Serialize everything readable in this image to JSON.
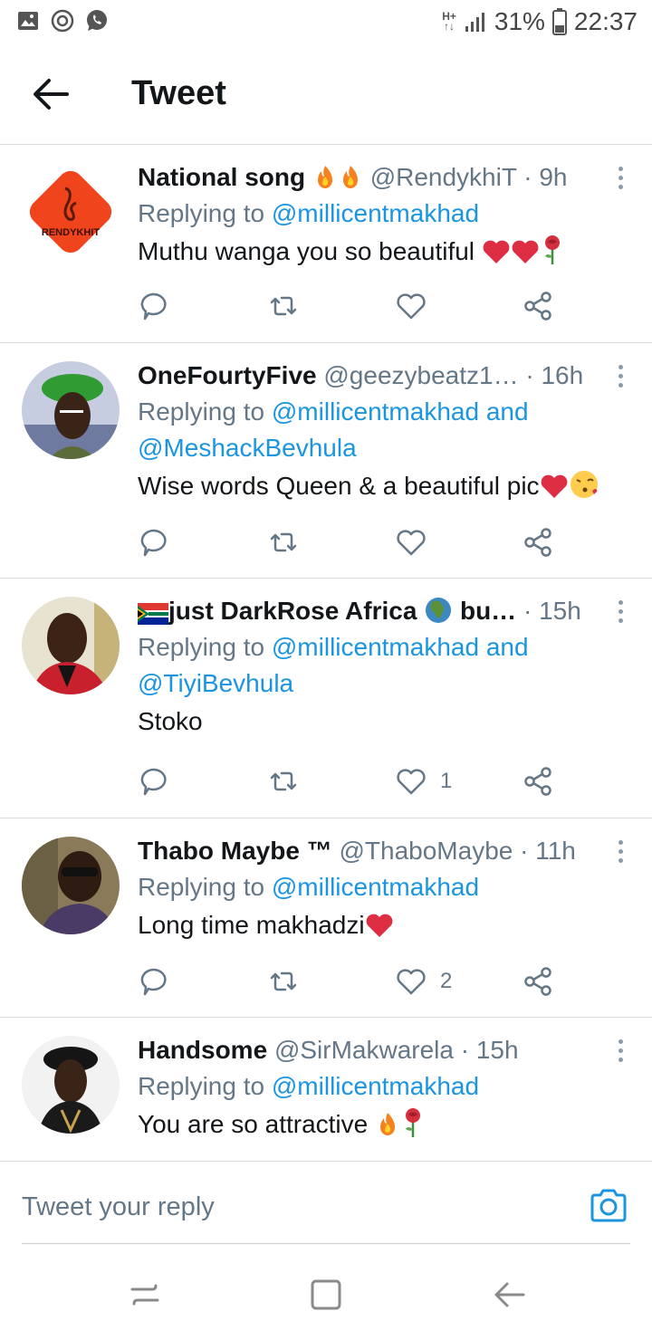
{
  "status_bar": {
    "network": [
      "H+",
      "↑↓"
    ],
    "battery": "31%",
    "time": "22:37",
    "icons": [
      "gallery-icon",
      "sync-icon",
      "whatsapp-icon",
      "signal-icon",
      "battery-icon"
    ]
  },
  "header": {
    "title": "Tweet",
    "back_icon": "back-arrow-icon"
  },
  "tweets": [
    {
      "name": "National song",
      "name_emojis": [
        "fire",
        "fire"
      ],
      "handle": "@RendykhiT",
      "time": "· 9h",
      "replying_prefix": "Replying to",
      "mentions": [
        "@millicentmakhad"
      ],
      "mentions_joiner": "",
      "text": "Muthu wanga you so beautiful",
      "text_emojis": [
        "heart",
        "heart",
        "rose"
      ],
      "like_count": "",
      "avatar": "rendykhit-logo"
    },
    {
      "name": "OneFourtyFive",
      "name_emojis": [],
      "handle": "@geezybeatz1…",
      "time": "· 16h",
      "replying_prefix": "Replying to",
      "mentions": [
        "@millicentmakhad",
        "@MeshackBevhula"
      ],
      "mentions_joiner": "and",
      "text": "Wise words Queen & a beautiful pic",
      "text_emojis": [
        "heart",
        "kiss"
      ],
      "like_count": "",
      "avatar": "photo-green-cap"
    },
    {
      "name": "just DarkRose Africa",
      "name_prefix_emoji": "south-africa-flag",
      "name_emojis": [
        "globe"
      ],
      "name_suffix": "bu…",
      "handle": "",
      "time": "· 15h",
      "replying_prefix": "Replying to",
      "mentions": [
        "@millicentmakhad",
        "@TiyiBevhula"
      ],
      "mentions_joiner": "and",
      "text": "Stoko",
      "text_emojis": [],
      "like_count": "1",
      "avatar": "photo-red-jacket"
    },
    {
      "name": "Thabo Maybe ™",
      "name_emojis": [],
      "handle": "@ThaboMaybe",
      "time": "· 11h",
      "replying_prefix": "Replying to",
      "mentions": [
        "@millicentmakhad"
      ],
      "mentions_joiner": "",
      "text": "Long time makhadzi",
      "text_emojis": [
        "heart"
      ],
      "like_count": "2",
      "avatar": "photo-sunglasses"
    },
    {
      "name": "Handsome",
      "name_emojis": [],
      "handle": "@SirMakwarela",
      "time": "· 15h",
      "replying_prefix": "Replying to",
      "mentions": [
        "@millicentmakhad"
      ],
      "mentions_joiner": "",
      "text": "You are so attractive",
      "text_emojis": [
        "fire",
        "rose"
      ],
      "like_count": "",
      "avatar": "photo-black-cap"
    }
  ],
  "reply_box": {
    "placeholder": "Tweet your reply",
    "camera_icon": "camera-icon"
  },
  "nav_bar": {
    "icons": [
      "recents-icon",
      "home-icon",
      "back-icon"
    ]
  },
  "colors": {
    "link": "#1b95e0",
    "secondary_text": "#657786",
    "divider": "#dcdcdc"
  }
}
